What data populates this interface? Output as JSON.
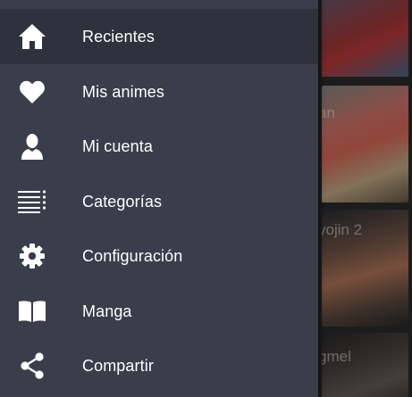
{
  "drawer": {
    "items": [
      {
        "label": "Recientes",
        "icon": "home-icon",
        "active": true
      },
      {
        "label": "Mis animes",
        "icon": "heart-icon",
        "active": false
      },
      {
        "label": "Mi cuenta",
        "icon": "person-icon",
        "active": false
      },
      {
        "label": "Categorías",
        "icon": "list-icon",
        "active": false
      },
      {
        "label": "Configuración",
        "icon": "gear-icon",
        "active": false
      },
      {
        "label": "Manga",
        "icon": "book-icon",
        "active": false
      },
      {
        "label": "Compartir",
        "icon": "share-icon",
        "active": false
      }
    ]
  },
  "background": {
    "cards": [
      {
        "title_fragment": ""
      },
      {
        "title_fragment": "an"
      },
      {
        "title_fragment": "yojin 2"
      },
      {
        "title_fragment": "gmel"
      }
    ]
  },
  "colors": {
    "drawer_bg": "#3a3e4b",
    "active_item_bg": "#2f323d",
    "icon_color": "#ffffff",
    "text_color": "#ffffff"
  }
}
